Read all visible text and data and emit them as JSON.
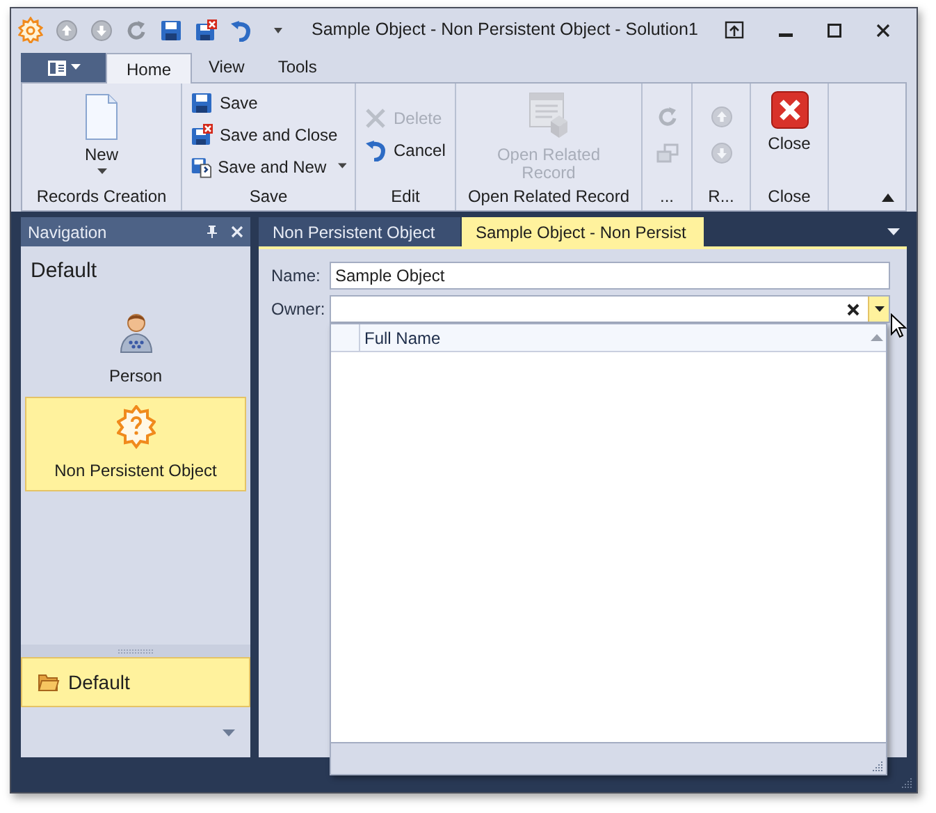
{
  "window": {
    "title": "Sample Object - Non Persistent Object - Solution1"
  },
  "ribbon": {
    "tabs": [
      {
        "label": "Home",
        "selected": true
      },
      {
        "label": "View",
        "selected": false
      },
      {
        "label": "Tools",
        "selected": false
      }
    ],
    "groups": [
      {
        "label": "Records Creation",
        "items": [
          {
            "kind": "large",
            "label": "New",
            "disabled": false,
            "dropdown": true
          }
        ]
      },
      {
        "label": "Save",
        "items": [
          {
            "kind": "small",
            "label": "Save",
            "disabled": false,
            "dropdown": false
          },
          {
            "kind": "small",
            "label": "Save and Close",
            "disabled": false,
            "dropdown": false
          },
          {
            "kind": "small",
            "label": "Save and New",
            "disabled": false,
            "dropdown": true
          }
        ]
      },
      {
        "label": "Edit",
        "items": [
          {
            "kind": "small",
            "label": "Delete",
            "disabled": true,
            "dropdown": false
          },
          {
            "kind": "small",
            "label": "Cancel",
            "disabled": false,
            "dropdown": false
          }
        ]
      },
      {
        "label": "Open Related Record",
        "items": [
          {
            "kind": "large",
            "label": "Open Related Record",
            "disabled": true,
            "dropdown": false
          }
        ]
      },
      {
        "label": "...",
        "items": [
          {
            "kind": "icon",
            "disabled": true
          },
          {
            "kind": "icon",
            "disabled": true
          }
        ]
      },
      {
        "label": "R...",
        "items": [
          {
            "kind": "icon",
            "disabled": true
          },
          {
            "kind": "icon",
            "disabled": true
          }
        ]
      },
      {
        "label": "Close",
        "items": [
          {
            "kind": "large",
            "label": "Close",
            "disabled": false,
            "dropdown": false
          }
        ]
      }
    ]
  },
  "navigation": {
    "title": "Navigation",
    "group_title": "Default",
    "items": [
      {
        "label": "Person",
        "selected": false
      },
      {
        "label": "Non Persistent Object",
        "selected": true
      }
    ],
    "groups": [
      {
        "label": "Default",
        "selected": true
      }
    ]
  },
  "document_tabs": [
    {
      "label": "Non Persistent Object",
      "selected": false
    },
    {
      "label": "Sample Object - Non Persist",
      "selected": true
    }
  ],
  "form": {
    "fields": [
      {
        "label": "Name:",
        "value": "Sample Object",
        "kind": "text"
      },
      {
        "label": "Owner:",
        "kind": "lookup",
        "expanded": true
      }
    ],
    "lookup_columns": [
      "Full Name"
    ]
  }
}
